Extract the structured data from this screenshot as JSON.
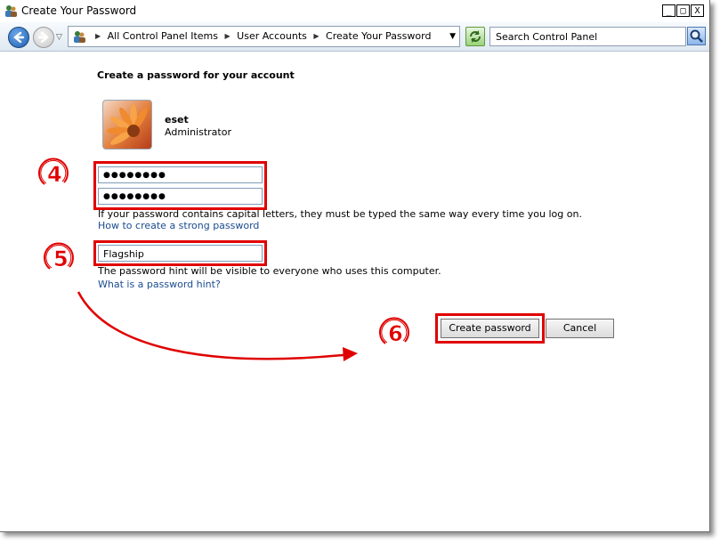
{
  "window": {
    "title": "Create Your Password",
    "minimize_glyph": "_",
    "maximize_glyph": "□",
    "close_glyph": "X"
  },
  "navbar": {
    "breadcrumbs": [
      "All Control Panel Items",
      "User Accounts",
      "Create Your Password"
    ],
    "search_placeholder": "Search Control Panel"
  },
  "content": {
    "heading": "Create a password for your account",
    "account": {
      "name": "eset",
      "role": "Administrator"
    },
    "password_masked": "●●●●●●●●",
    "confirm_masked": "●●●●●●●●",
    "caps_note": "If your password contains capital letters, they must be typed the same way every time you log on.",
    "strong_password_link": "How to create a strong password",
    "hint_value": "Flagship",
    "hint_note": "The password hint will be visible to everyone who uses this computer.",
    "hint_link": "What is a password hint?",
    "create_button": "Create password",
    "cancel_button": "Cancel"
  },
  "annotations": {
    "step4": "4",
    "step5": "5",
    "step6": "6",
    "highlight_color": "#e00000"
  }
}
